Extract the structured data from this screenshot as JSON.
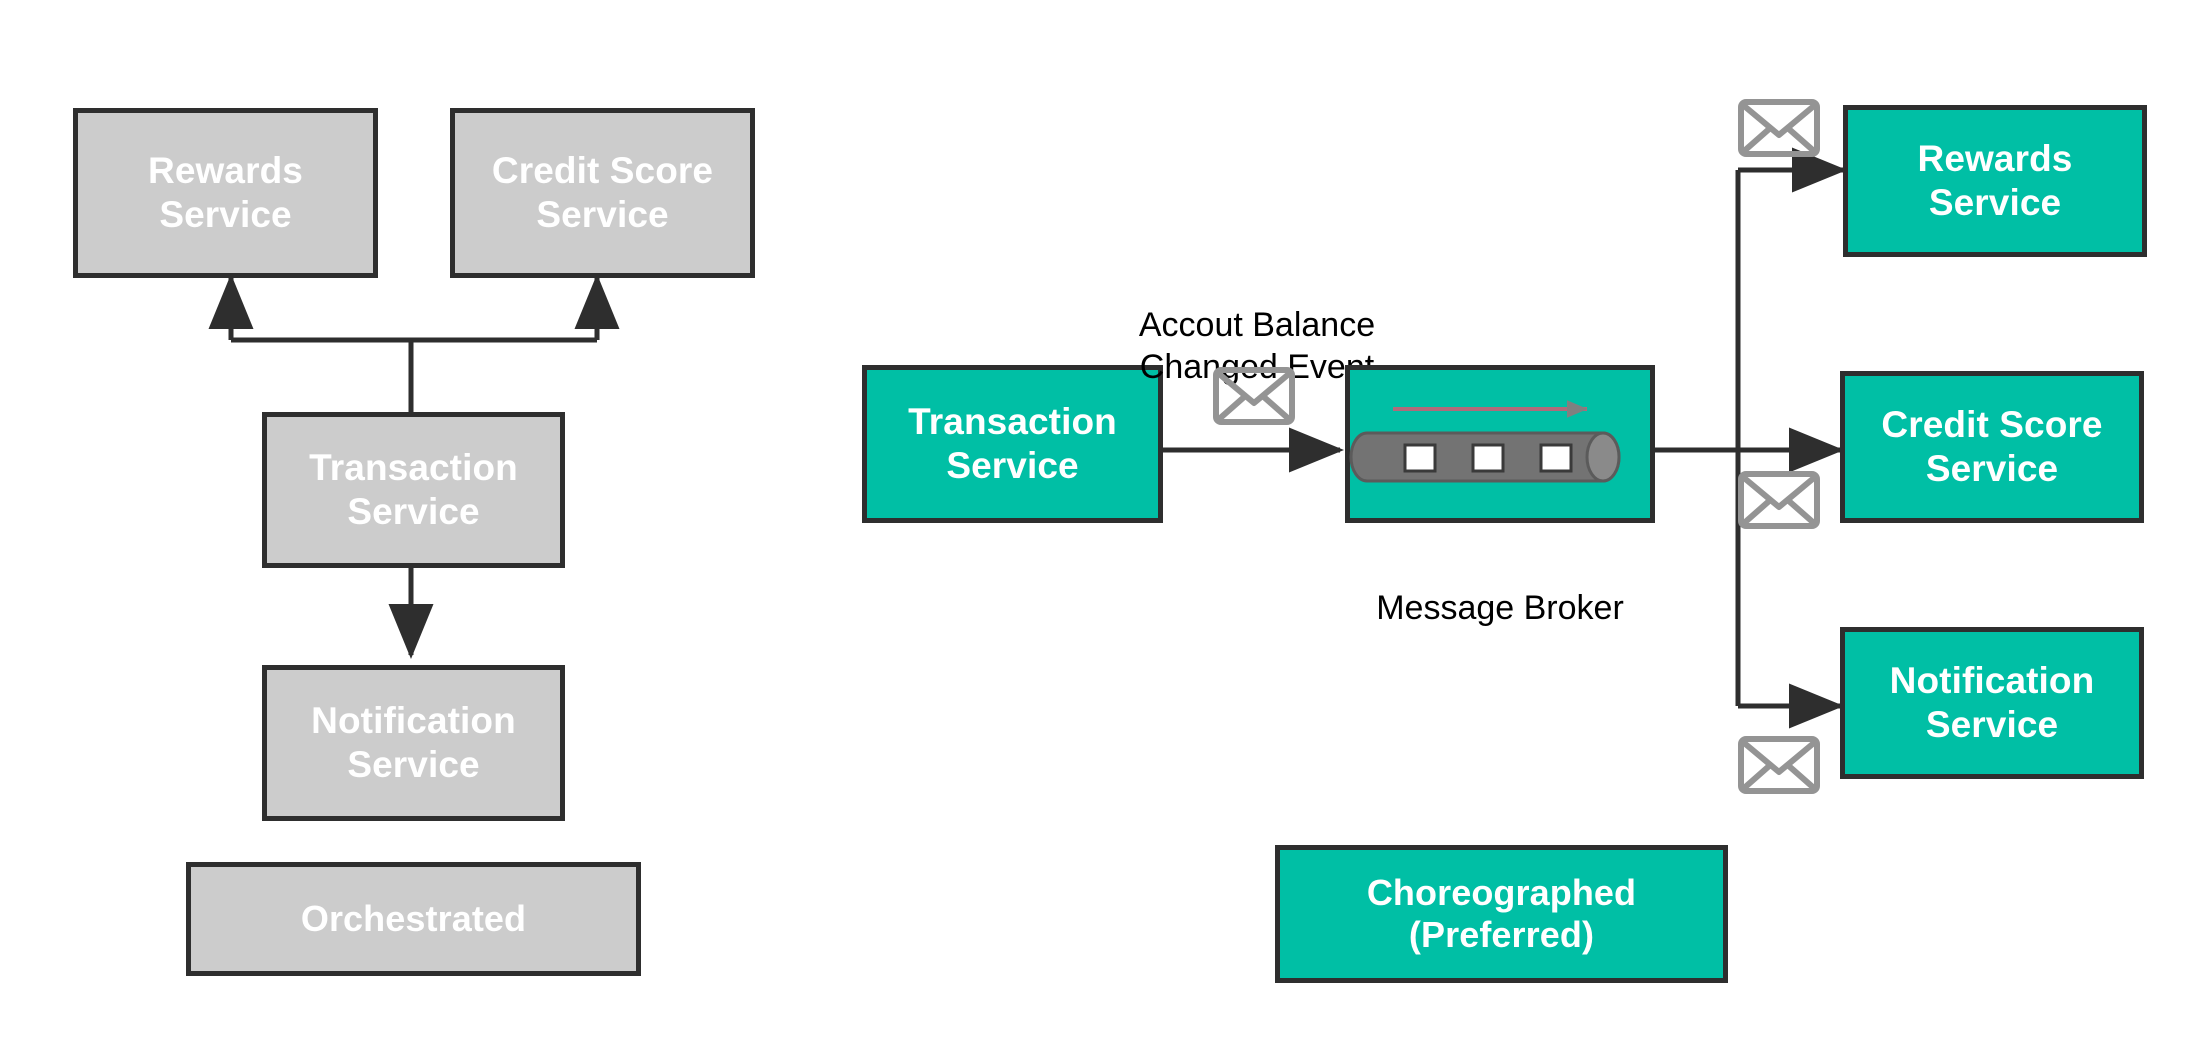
{
  "diagram": {
    "title_not_shown": "",
    "colors": {
      "gray_fill": "#cccccc",
      "teal_fill": "#00bfa5",
      "stroke": "#2e2e2e",
      "envelope_stroke": "#949494",
      "broker_tube": "#737373",
      "broker_flow_line": "#b06a7a",
      "text_on_fill": "#ffffff",
      "plain_text": "#000000",
      "background": "#ffffff"
    },
    "left_panel": {
      "name": "orchestrated-pattern",
      "nodes": [
        {
          "id": "left-rewards",
          "label": "Rewards\nService"
        },
        {
          "id": "left-credit-score",
          "label": "Credit Score\nService"
        },
        {
          "id": "left-transaction",
          "label": "Transaction\nService"
        },
        {
          "id": "left-notification",
          "label": "Notification\nService"
        }
      ],
      "caption": "Orchestrated"
    },
    "right_panel": {
      "name": "choreographed-pattern",
      "source_node": {
        "id": "right-transaction",
        "label": "Transaction\nService"
      },
      "event_label": "Accout Balance\nChanged Event",
      "broker": {
        "id": "message-broker",
        "caption": "Message Broker",
        "queue_message_count": 3
      },
      "consumers": [
        {
          "id": "right-rewards",
          "label": "Rewards\nService"
        },
        {
          "id": "right-credit-score",
          "label": "Credit Score\nService"
        },
        {
          "id": "right-notification",
          "label": "Notification\nService"
        }
      ],
      "caption": "Choreographed\n(Preferred)"
    },
    "envelopes": [
      {
        "id": "envelope-event",
        "near": "event-label"
      },
      {
        "id": "envelope-rewards",
        "near": "right-rewards"
      },
      {
        "id": "envelope-credit-score",
        "near": "right-credit-score"
      },
      {
        "id": "envelope-notification",
        "near": "right-notification"
      }
    ]
  }
}
